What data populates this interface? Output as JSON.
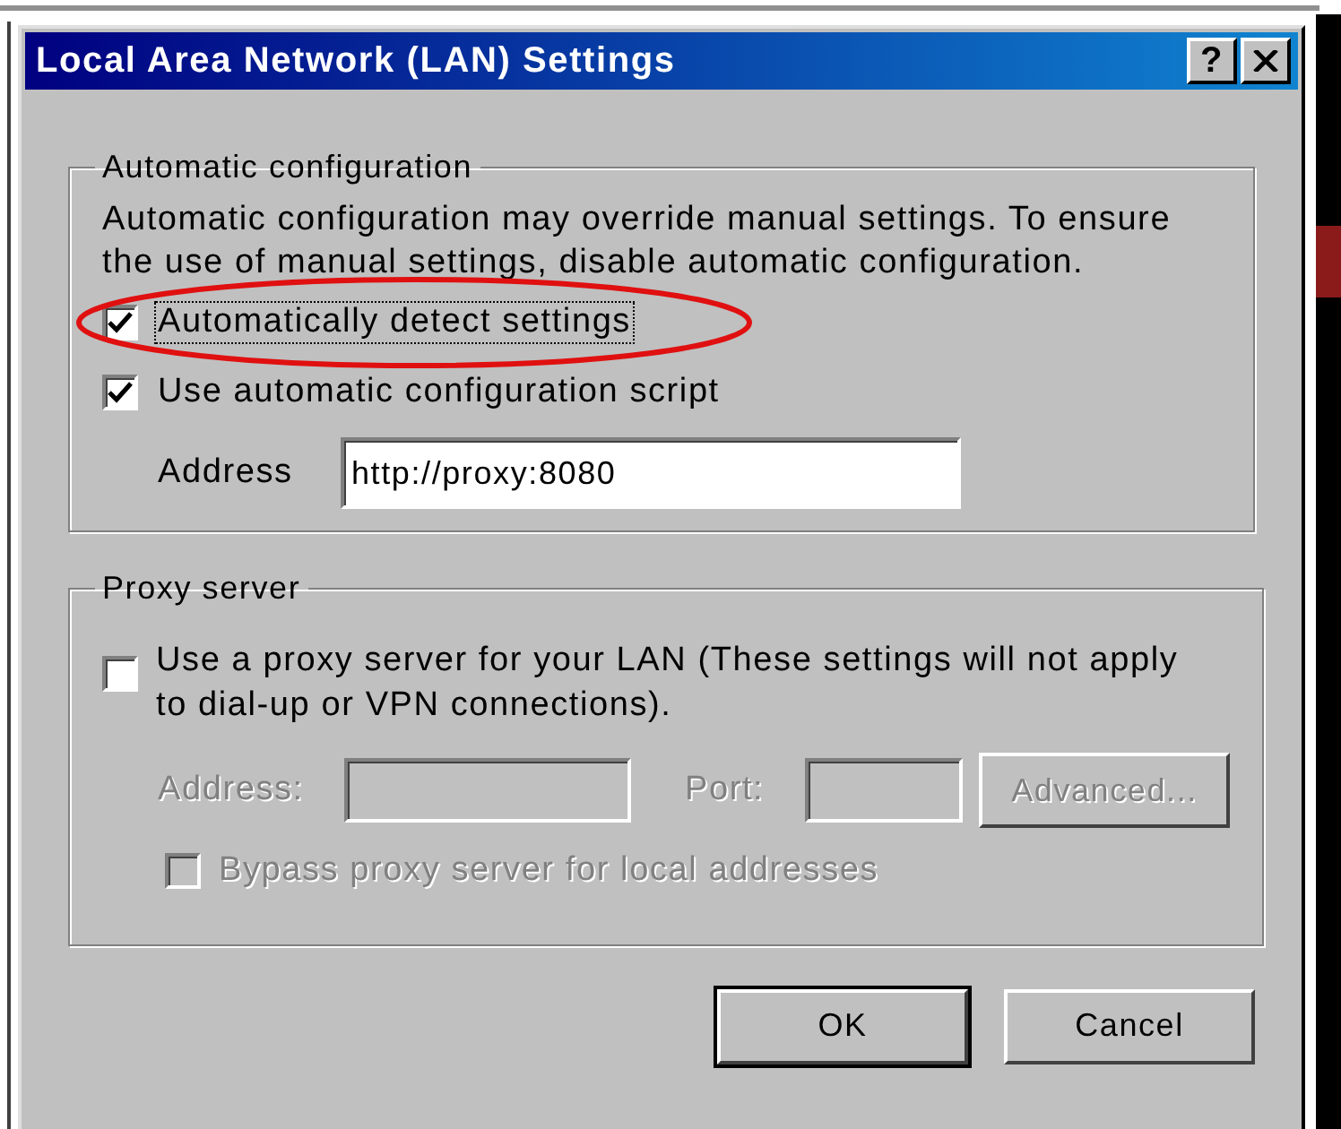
{
  "window": {
    "title": "Local Area Network (LAN) Settings",
    "title_buttons": [
      {
        "kind": "help",
        "label": "?"
      },
      {
        "kind": "close"
      }
    ]
  },
  "automatic_configuration": {
    "title": "Automatic configuration",
    "description": "Automatic configuration may override manual settings.  To ensure the use of manual settings, disable automatic configuration.",
    "options": [
      {
        "label": "Automatically detect settings",
        "checked": true,
        "focused": true,
        "highlighted": true
      },
      {
        "label": "Use automatic configuration script",
        "checked": true,
        "focused": false,
        "highlighted": false
      }
    ],
    "address": {
      "label": "Address",
      "value": "http://proxy:8080"
    }
  },
  "proxy_server": {
    "title": "Proxy server",
    "use_proxy": {
      "label": "Use a proxy server for your LAN (These settings will not apply to dial-up or VPN connections).",
      "checked": false
    },
    "address": {
      "label": "Address:",
      "disabled": true
    },
    "port": {
      "label": "Port:",
      "disabled": true
    },
    "advanced_button": {
      "label": "Advanced...",
      "disabled": true
    },
    "bypass": {
      "label": "Bypass proxy server for local addresses",
      "checked": false,
      "disabled": true
    }
  },
  "buttons": [
    {
      "label": "OK",
      "default": true
    },
    {
      "label": "Cancel",
      "default": false
    }
  ]
}
